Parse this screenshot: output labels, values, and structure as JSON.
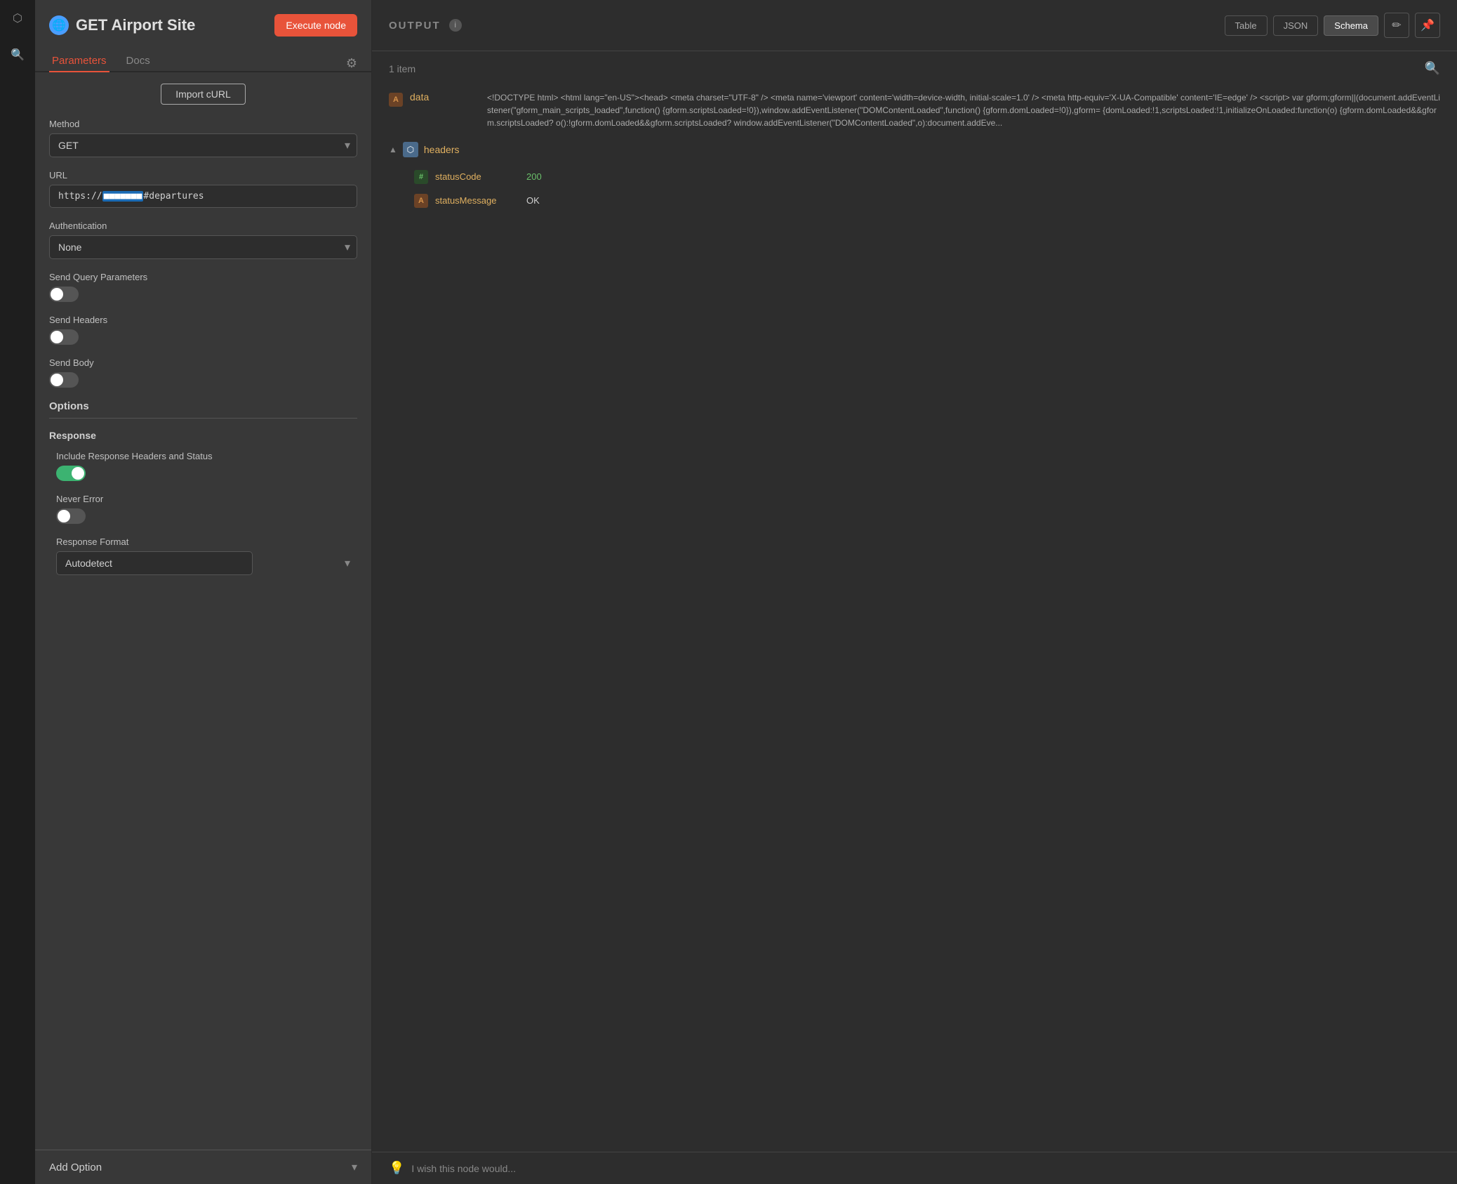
{
  "sidebar": {
    "icons": [
      "⬡",
      "🔍"
    ]
  },
  "panel": {
    "node_icon": "🌐",
    "node_title": "GET Airport Site",
    "execute_btn": "Execute node",
    "tabs": [
      {
        "id": "parameters",
        "label": "Parameters",
        "active": true
      },
      {
        "id": "docs",
        "label": "Docs",
        "active": false
      }
    ],
    "import_curl_btn": "Import cURL",
    "method_label": "Method",
    "method_value": "GET",
    "url_label": "URL",
    "url_prefix": "https://",
    "url_highlight": "highlighted",
    "url_suffix": "#departures",
    "auth_label": "Authentication",
    "auth_value": "None",
    "send_query_label": "Send Query Parameters",
    "send_query_on": false,
    "send_headers_label": "Send Headers",
    "send_headers_on": false,
    "send_body_label": "Send Body",
    "send_body_on": false,
    "options_title": "Options",
    "response_title": "Response",
    "include_response_label": "Include Response Headers and Status",
    "include_response_on": true,
    "never_error_label": "Never Error",
    "never_error_on": false,
    "response_format_label": "Response Format",
    "response_format_value": "Autodetect",
    "add_option_label": "Add Option"
  },
  "output": {
    "title": "OUTPUT",
    "item_count": "1 item",
    "view_table": "Table",
    "view_json": "JSON",
    "view_schema": "Schema",
    "edit_icon": "✏️",
    "pin_icon": "📌",
    "search_icon": "🔍",
    "data_key": "data",
    "data_type": "A",
    "data_value": "<!DOCTYPE html> <html lang=\"en-US\"><head> <meta charset=\"UTF-8\" /> <meta name='viewport' content='width=device-width, initial-scale=1.0' /> <meta http-equiv='X-UA-Compatible' content='IE=edge' /> <script> var gform;gform||(document.addEventListener(\"gform_main_scripts_loaded\",function() {gform.scriptsLoaded=!0}),window.addEventListener(\"DOMContentLoaded\",function() {gform.domLoaded=!0}),gform= {domLoaded:!1,scriptsLoaded:!1,initializeOnLoaded:function(o) {gform.domLoaded&&gform.scriptsLoaded? o():!gform.domLoaded&&gform.scriptsLoaded? window.addEventListener(\"DOMContentLoaded\",o):document.addEve...",
    "headers_section": {
      "label": "headers",
      "expanded": true,
      "items": [
        {
          "type": "#",
          "key": "statusCode",
          "value": "200"
        },
        {
          "type": "A",
          "key": "statusMessage",
          "value": "OK"
        }
      ]
    },
    "wish_text": "I wish this node would..."
  }
}
